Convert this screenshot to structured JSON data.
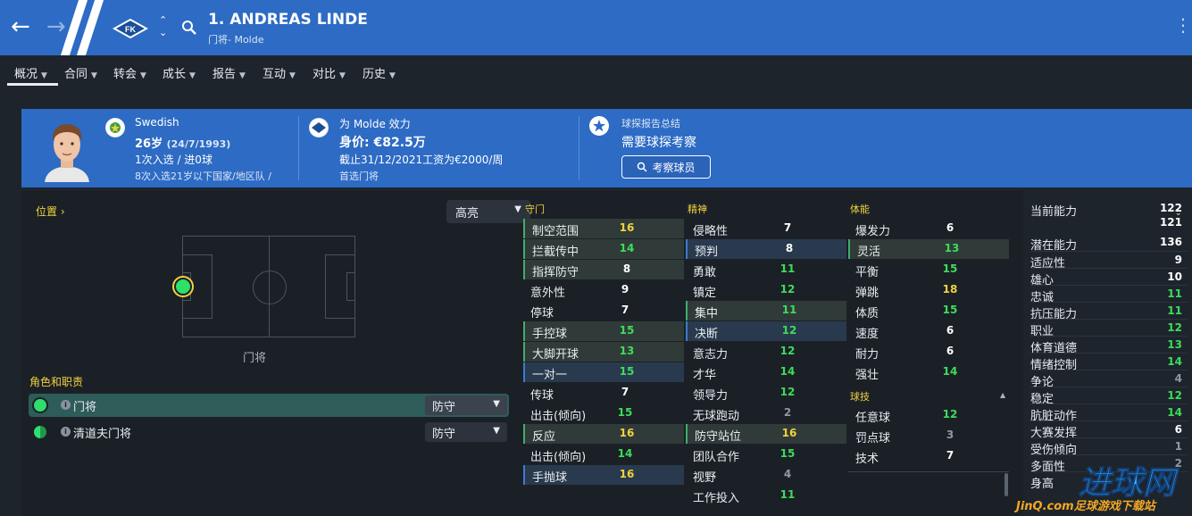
{
  "header": {
    "title": "1. ANDREAS LINDE",
    "subtitle": "门将- Molde",
    "back_icon": "arrow-left-icon",
    "forward_icon": "arrow-right-icon",
    "search_icon": "search-icon",
    "club_logo_text": "FK",
    "brand_color": "#2d6bc4"
  },
  "tabs": [
    {
      "label": "概况",
      "active": true
    },
    {
      "label": "合同"
    },
    {
      "label": "转会"
    },
    {
      "label": "成长"
    },
    {
      "label": "报告"
    },
    {
      "label": "互动"
    },
    {
      "label": "对比"
    },
    {
      "label": "历史"
    }
  ],
  "profile": {
    "nationality": "Swedish",
    "age": "26岁",
    "dob": "(24/7/1993)",
    "caps": "1次入选 / 进0球",
    "youth_caps": "8次入选21岁以下国家/地区队 /"
  },
  "club_info": {
    "plays_for": "为 Molde 效力",
    "value": "身价: €82.5万",
    "wage": "截止31/12/2021工资为€2000/周",
    "squad_status": "首选门将"
  },
  "scout": {
    "title": "球探报告总结",
    "status": "需要球探考察",
    "button_label": "考察球员"
  },
  "position": {
    "label": "位置",
    "highlight_select": "高亮",
    "pitch_role_label": "门将",
    "roles_title": "角色和职责",
    "roles": [
      {
        "name": "门将",
        "duty": "防守",
        "active": true
      },
      {
        "name": "清道夫门将",
        "duty": "防守",
        "active": false
      }
    ]
  },
  "attributes": {
    "goalkeeping": {
      "title": "守门",
      "items": [
        {
          "name": "制空范围",
          "value": "16",
          "color": "yellow",
          "hl": "green"
        },
        {
          "name": "拦截传中",
          "value": "14",
          "color": "green",
          "hl": "green"
        },
        {
          "name": "指挥防守",
          "value": "8",
          "color": "white",
          "hl": "green"
        },
        {
          "name": "意外性",
          "value": "9",
          "color": "white",
          "hl": ""
        },
        {
          "name": "停球",
          "value": "7",
          "color": "white",
          "hl": ""
        },
        {
          "name": "手控球",
          "value": "15",
          "color": "green",
          "hl": "green"
        },
        {
          "name": "大脚开球",
          "value": "13",
          "color": "green",
          "hl": "green"
        },
        {
          "name": "一对一",
          "value": "15",
          "color": "green",
          "hl": "blue"
        },
        {
          "name": "传球",
          "value": "7",
          "color": "white",
          "hl": ""
        },
        {
          "name": "出击(倾向)",
          "value": "15",
          "color": "green",
          "hl": ""
        },
        {
          "name": "反应",
          "value": "16",
          "color": "yellow",
          "hl": "green"
        },
        {
          "name": "出击(倾向)",
          "value": "14",
          "color": "green",
          "hl": ""
        },
        {
          "name": "手抛球",
          "value": "16",
          "color": "yellow",
          "hl": "blue"
        }
      ]
    },
    "mental": {
      "title": "精神",
      "items": [
        {
          "name": "侵略性",
          "value": "7",
          "color": "white",
          "hl": ""
        },
        {
          "name": "预判",
          "value": "8",
          "color": "white",
          "hl": "blue"
        },
        {
          "name": "勇敢",
          "value": "11",
          "color": "green",
          "hl": ""
        },
        {
          "name": "镇定",
          "value": "12",
          "color": "green",
          "hl": ""
        },
        {
          "name": "集中",
          "value": "11",
          "color": "green",
          "hl": "green"
        },
        {
          "name": "决断",
          "value": "12",
          "color": "green",
          "hl": "blue"
        },
        {
          "name": "意志力",
          "value": "12",
          "color": "green",
          "hl": ""
        },
        {
          "name": "才华",
          "value": "14",
          "color": "green",
          "hl": ""
        },
        {
          "name": "领导力",
          "value": "12",
          "color": "green",
          "hl": ""
        },
        {
          "name": "无球跑动",
          "value": "2",
          "color": "grey",
          "hl": ""
        },
        {
          "name": "防守站位",
          "value": "16",
          "color": "yellow",
          "hl": "green"
        },
        {
          "name": "团队合作",
          "value": "15",
          "color": "green",
          "hl": ""
        },
        {
          "name": "视野",
          "value": "4",
          "color": "grey",
          "hl": ""
        },
        {
          "name": "工作投入",
          "value": "11",
          "color": "green",
          "hl": ""
        }
      ]
    },
    "physical": {
      "title": "体能",
      "items": [
        {
          "name": "爆发力",
          "value": "6",
          "color": "white",
          "hl": ""
        },
        {
          "name": "灵活",
          "value": "13",
          "color": "green",
          "hl": "green"
        },
        {
          "name": "平衡",
          "value": "15",
          "color": "green",
          "hl": ""
        },
        {
          "name": "弹跳",
          "value": "18",
          "color": "yellow",
          "hl": ""
        },
        {
          "name": "体质",
          "value": "15",
          "color": "green",
          "hl": ""
        },
        {
          "name": "速度",
          "value": "6",
          "color": "white",
          "hl": ""
        },
        {
          "name": "耐力",
          "value": "6",
          "color": "white",
          "hl": ""
        },
        {
          "name": "强壮",
          "value": "14",
          "color": "green",
          "hl": ""
        }
      ]
    },
    "technical": {
      "title": "球技",
      "items": [
        {
          "name": "任意球",
          "value": "12",
          "color": "green",
          "hl": ""
        },
        {
          "name": "罚点球",
          "value": "3",
          "color": "grey",
          "hl": ""
        },
        {
          "name": "技术",
          "value": "7",
          "color": "white",
          "hl": ""
        }
      ]
    }
  },
  "side_stats": [
    {
      "name": "当前能力",
      "value": "122",
      "color": "white"
    },
    {
      "name": "",
      "value": "121",
      "color": "white"
    },
    {
      "name": "潜在能力",
      "value": "136",
      "color": "white"
    },
    {
      "name": "适应性",
      "value": "9",
      "color": "white"
    },
    {
      "name": "雄心",
      "value": "10",
      "color": "white"
    },
    {
      "name": "忠诚",
      "value": "11",
      "color": "green"
    },
    {
      "name": "抗压能力",
      "value": "11",
      "color": "green"
    },
    {
      "name": "职业",
      "value": "12",
      "color": "green"
    },
    {
      "name": "体育道德",
      "value": "13",
      "color": "green"
    },
    {
      "name": "情绪控制",
      "value": "14",
      "color": "green"
    },
    {
      "name": "争论",
      "value": "4",
      "color": "grey"
    },
    {
      "name": "稳定",
      "value": "12",
      "color": "green"
    },
    {
      "name": "肮脏动作",
      "value": "14",
      "color": "green"
    },
    {
      "name": "大赛发挥",
      "value": "6",
      "color": "white"
    },
    {
      "name": "受伤倾向",
      "value": "1",
      "color": "grey"
    },
    {
      "name": "多面性",
      "value": "2",
      "color": "grey"
    },
    {
      "name": "身高",
      "value": "",
      "color": "white"
    }
  ],
  "watermark": {
    "title": "进球网",
    "subtitle": "JinQ.com足球游戏下载站"
  }
}
